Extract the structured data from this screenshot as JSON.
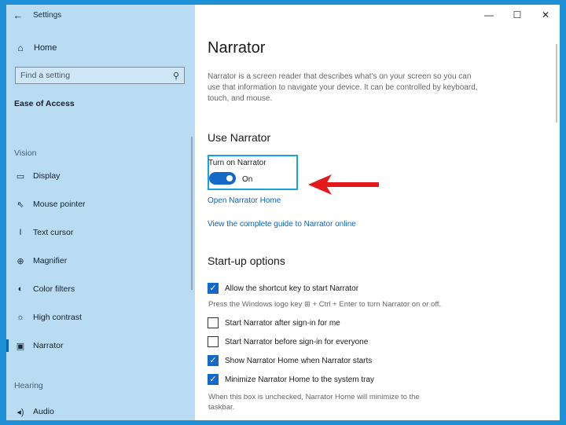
{
  "window": {
    "title": "Settings",
    "controls": {
      "minimize": "—",
      "maximize": "☐",
      "close": "✕"
    }
  },
  "sidebar": {
    "home_label": "Home",
    "search_placeholder": "Find a setting",
    "section_title": "Ease of Access",
    "groups": [
      {
        "label": "Vision"
      },
      {
        "label": "Hearing"
      }
    ],
    "items": [
      {
        "label": "Display",
        "icon": "display-icon"
      },
      {
        "label": "Mouse pointer",
        "icon": "mouse-pointer-icon"
      },
      {
        "label": "Text cursor",
        "icon": "text-cursor-icon"
      },
      {
        "label": "Magnifier",
        "icon": "magnifier-icon"
      },
      {
        "label": "Color filters",
        "icon": "color-filters-icon"
      },
      {
        "label": "High contrast",
        "icon": "high-contrast-icon"
      },
      {
        "label": "Narrator",
        "icon": "narrator-icon",
        "selected": true
      },
      {
        "label": "Audio",
        "icon": "audio-icon"
      }
    ]
  },
  "main": {
    "title": "Narrator",
    "description": "Narrator is a screen reader that describes what's on your screen so you can use that information to navigate your device. It can be controlled by keyboard, touch, and mouse.",
    "use_heading": "Use Narrator",
    "toggle": {
      "label": "Turn on Narrator",
      "state": "On",
      "on": true
    },
    "links": {
      "home": "Open Narrator Home",
      "guide": "View the complete guide to Narrator online"
    },
    "startup_heading": "Start-up options",
    "options": [
      {
        "label": "Allow the shortcut key to start Narrator",
        "checked": true
      },
      {
        "label": "Start Narrator after sign-in for me",
        "checked": false
      },
      {
        "label": "Start Narrator before sign-in for everyone",
        "checked": false
      },
      {
        "label": "Show Narrator Home when Narrator starts",
        "checked": true
      },
      {
        "label": "Minimize Narrator Home to the system tray",
        "checked": true
      }
    ],
    "shortcut_hint": "Press the Windows logo key ⊞ + Ctrl + Enter to turn Narrator on or off.",
    "tray_hint_line1": "When this box is unchecked, Narrator Home will minimize to the",
    "tray_hint_line2": "taskbar."
  },
  "colors": {
    "desktop": "#1e90d6",
    "sidebar": "#b9dcf3",
    "accent": "#1469c8",
    "highlight": "#16a3e0",
    "arrow": "#e3191b"
  }
}
